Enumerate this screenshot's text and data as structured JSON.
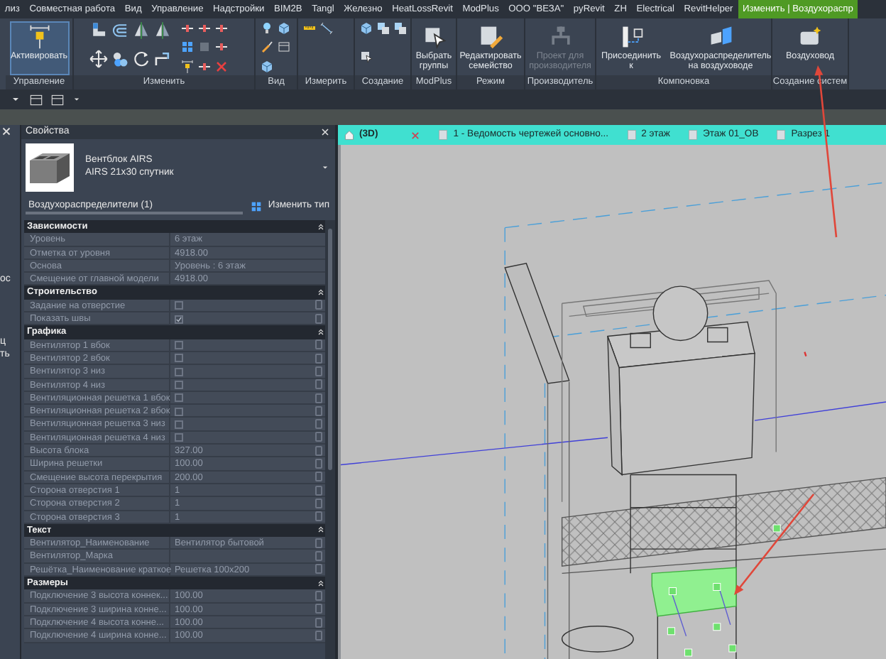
{
  "ribbon": {
    "tabs": [
      {
        "label": "лиз",
        "selected": false
      },
      {
        "label": "Совместная работа",
        "selected": false
      },
      {
        "label": "Вид",
        "selected": false
      },
      {
        "label": "Управление",
        "selected": false
      },
      {
        "label": "Надстройки",
        "selected": false
      },
      {
        "label": "BIM2B",
        "selected": false
      },
      {
        "label": "Tangl",
        "selected": false
      },
      {
        "label": "Железно",
        "selected": false
      },
      {
        "label": "HeatLossRevit",
        "selected": false
      },
      {
        "label": "ModPlus",
        "selected": false
      },
      {
        "label": "ООО \"ВЕЗА\"",
        "selected": false
      },
      {
        "label": "pyRevit",
        "selected": false
      },
      {
        "label": "ZH",
        "selected": false
      },
      {
        "label": "Electrical",
        "selected": false
      },
      {
        "label": "RevitHelper",
        "selected": false
      },
      {
        "label": "Изменить | Воздухораспр",
        "selected": true
      }
    ],
    "panels": [
      {
        "label": "Управление",
        "buttons": [
          {
            "label": "Активировать",
            "active": true,
            "disabled": false
          }
        ]
      },
      {
        "label": "Изменить"
      },
      {
        "label": "Вид"
      },
      {
        "label": "Измерить"
      },
      {
        "label": "Создание"
      },
      {
        "label": "ModPlus",
        "buttons": [
          {
            "label": "Выбрать группы",
            "active": false,
            "disabled": false
          }
        ]
      },
      {
        "label": "Режим",
        "buttons": [
          {
            "label": "Редактировать семейство",
            "active": false,
            "disabled": false
          }
        ]
      },
      {
        "label": "Производитель",
        "buttons": [
          {
            "label": "Проект для производителя",
            "active": false,
            "disabled": true
          }
        ]
      },
      {
        "label": "Компоновка",
        "buttons": [
          {
            "label": "Присоединить к",
            "active": false,
            "disabled": false
          },
          {
            "label": "Воздухораспределитель на воздуховоде",
            "active": false,
            "disabled": false
          }
        ]
      },
      {
        "label": "Создание систем",
        "buttons": [
          {
            "label": "Воздуховод",
            "active": false,
            "disabled": false
          }
        ]
      }
    ]
  },
  "left_panel": {
    "texts": [
      "ос",
      "ц",
      "ть"
    ]
  },
  "properties": {
    "title": "Свойства",
    "family": "Вентблок AIRS",
    "type": "AIRS 21x30 спутник",
    "filter": "Воздухораспределители (1)",
    "edit_type": "Изменить тип",
    "sections": [
      {
        "title": "Зависимости",
        "associate_buttons": false,
        "rows": [
          {
            "kind": "value",
            "name": "Уровень",
            "value": "6 этаж"
          },
          {
            "kind": "value",
            "name": "Отметка от уровня",
            "value": "4918.00"
          },
          {
            "kind": "value",
            "name": "Основа",
            "value": "Уровень : 6 этаж"
          },
          {
            "kind": "value",
            "name": "Смещение от главной модели",
            "value": "4918.00"
          }
        ]
      },
      {
        "title": "Строительство",
        "associate_buttons": true,
        "rows": [
          {
            "kind": "checkbox",
            "name": "Задание на отверстие",
            "checked": false
          },
          {
            "kind": "checkbox",
            "name": "Показать швы",
            "checked": true
          }
        ]
      },
      {
        "title": "Графика",
        "associate_buttons": true,
        "rows": [
          {
            "kind": "checkbox",
            "name": "Вентилятор 1 вбок",
            "checked": false
          },
          {
            "kind": "checkbox",
            "name": "Вентилятор 2 вбок",
            "checked": false
          },
          {
            "kind": "checkbox",
            "name": "Вентилятор 3 низ",
            "checked": false
          },
          {
            "kind": "checkbox",
            "name": "Вентилятор 4 низ",
            "checked": false
          },
          {
            "kind": "checkbox",
            "name": "Вентиляционная решетка 1 вбок",
            "checked": false
          },
          {
            "kind": "checkbox",
            "name": "Вентиляционная решетка 2 вбок",
            "checked": false
          },
          {
            "kind": "checkbox",
            "name": "Вентиляционная решетка 3 низ",
            "checked": false
          },
          {
            "kind": "checkbox",
            "name": "Вентиляционная решетка 4 низ",
            "checked": false
          },
          {
            "kind": "value",
            "name": "Высота блока",
            "value": "327.00"
          },
          {
            "kind": "value",
            "name": "Ширина решетки",
            "value": "100.00"
          },
          {
            "kind": "value",
            "name": "Смещение высота перекрытия",
            "value": "200.00"
          },
          {
            "kind": "value",
            "name": "Сторона отверстия 1",
            "value": "1"
          },
          {
            "kind": "value",
            "name": "Сторона отверстия 2",
            "value": "1"
          },
          {
            "kind": "value",
            "name": "Сторона отверстия 3",
            "value": "1"
          }
        ]
      },
      {
        "title": "Текст",
        "associate_buttons": true,
        "rows": [
          {
            "kind": "value",
            "name": "Вентилятор_Наименование",
            "value": "Вентилятор бытовой"
          },
          {
            "kind": "value",
            "name": "Вентилятор_Марка"
          },
          {
            "kind": "value",
            "name": "Решётка_Наименование краткое",
            "value": "Решетка 100x200"
          }
        ]
      },
      {
        "title": "Размеры",
        "associate_buttons": true,
        "rows": [
          {
            "kind": "value",
            "name": "Подключение 3 высота коннек...",
            "value": "100.00"
          },
          {
            "kind": "value",
            "name": "Подключение 3 ширина конне...",
            "value": "100.00"
          },
          {
            "kind": "value",
            "name": "Подключение 4 высота конне...",
            "value": "100.00"
          },
          {
            "kind": "value",
            "name": "Подключение 4 ширина конне...",
            "value": "100.00"
          }
        ]
      }
    ]
  },
  "view_tabs": [
    {
      "label": "(3D)",
      "selected": true
    },
    {
      "label": "1 - Ведомость чертежей основно...",
      "selected": false
    },
    {
      "label": "2 этаж",
      "selected": false
    },
    {
      "label": "Этаж 01_ОВ",
      "selected": false
    },
    {
      "label": "Разрез 1",
      "selected": false
    }
  ]
}
